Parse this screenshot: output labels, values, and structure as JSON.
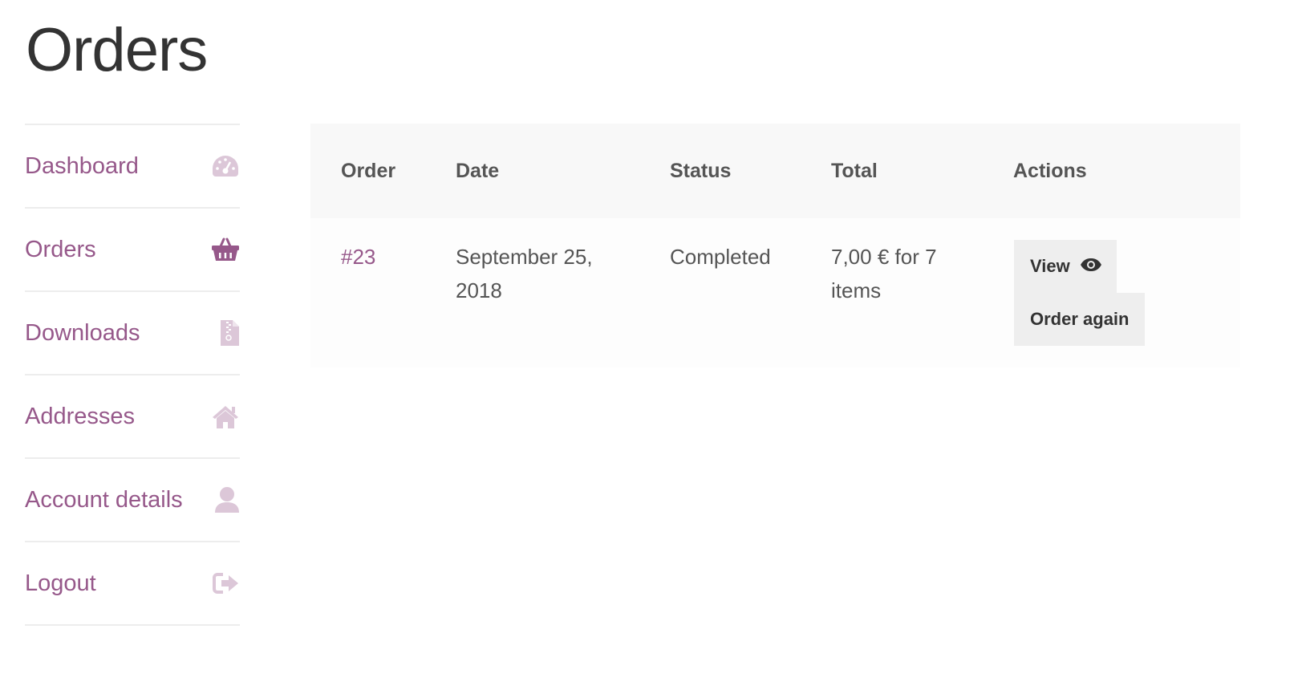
{
  "page": {
    "title": "Orders"
  },
  "nav": {
    "items": [
      {
        "label": "Dashboard",
        "icon": "dashboard-gauge-icon"
      },
      {
        "label": "Orders",
        "icon": "basket-icon",
        "active": true
      },
      {
        "label": "Downloads",
        "icon": "file-archive-icon"
      },
      {
        "label": "Addresses",
        "icon": "home-icon"
      },
      {
        "label": "Account details",
        "icon": "user-icon"
      },
      {
        "label": "Logout",
        "icon": "sign-out-icon"
      }
    ]
  },
  "table": {
    "headers": {
      "order": "Order",
      "date": "Date",
      "status": "Status",
      "total": "Total",
      "actions": "Actions"
    },
    "rows": [
      {
        "order": "#23",
        "date": "September 25, 2018",
        "status": "Completed",
        "total": "7,00 € for 7 items",
        "actions": {
          "view": "View",
          "order_again": "Order again"
        }
      }
    ]
  },
  "colors": {
    "accent": "#96588a",
    "icon_muted": "#dcc7d8",
    "header_bg": "#f8f8f8",
    "button_bg": "#eeeeee"
  }
}
